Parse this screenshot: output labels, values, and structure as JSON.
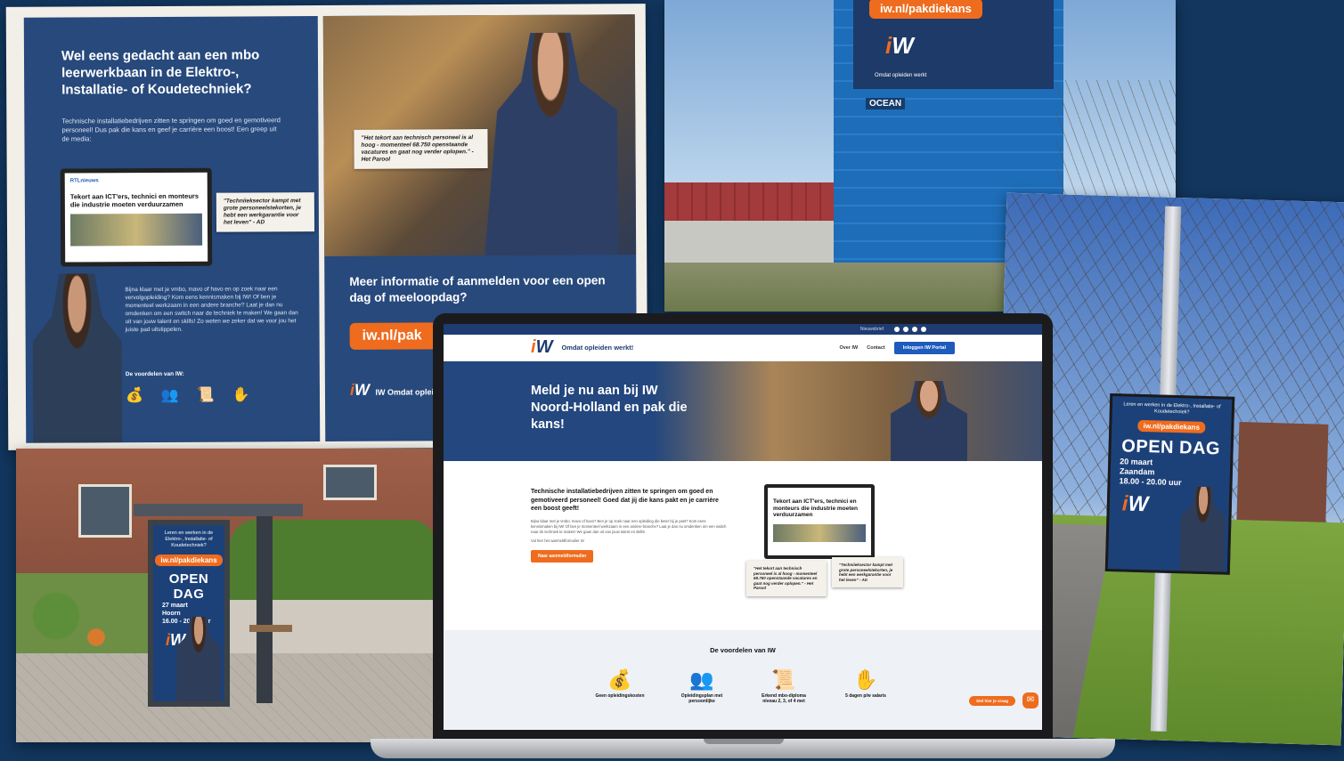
{
  "newspaper": {
    "left_headline": "Wel eens gedacht aan een mbo leerwerkbaan in de Elektro-, Installatie- of Koudetechniek?",
    "left_body": "Technische installatiebedrijven zitten te springen om goed en gemotiveerd personeel! Dus pak die kans en geef je carrière een boost! Een greep uit de media:",
    "article_source": "RTLnieuws",
    "article_title": "Tekort aan ICT'ers, technici en monteurs die industrie moeten verduurzamen",
    "quote_ab": "\"Techniieksector kampt met grote personeelstekorten, je hebt een werkgarantie voor het leven\" - AD",
    "left_body2": "Bijna klaar met je vmbo, mavo of havo en op zoek naar een vervolgopleiding? Kom eens kennismaken bij IW! Of ben je momenteel werkzaam in een andere branche? Laat je dan nu omdenken om een switch naar de techniek te maken! We gaan dan uit van jouw talent en skills! Zo weten we zeker dat we voor jou het juiste pad uitstippelen.",
    "benefits_title": "De voordelen van IW:",
    "quote_parool": "\"Het tekort aan technisch personeel is al hoog - momenteel 68.750 openstaande vacatures en gaat nog verder oplopen.\" - Het Parool",
    "right_cta": "Meer informatie of aanmelden voor een open dag of meeloopdag?",
    "right_url": "iw.nl/pak",
    "brand_line": "IW Omdat opleid"
  },
  "billboard": {
    "url": "iw.nl/pakdiekans",
    "tagline": "Omdat opleiden werkt",
    "tower_label": "OCEAN"
  },
  "roadside_poster": {
    "small": "Leren en werken in de Elektro-, Installatie- of Koudetechniek?",
    "url": "iw.nl/pakdiekans",
    "open_dag": "OPEN DAG",
    "date": "20 maart",
    "place": "Zaandam",
    "time": "18.00 - 20.00 uur"
  },
  "shelter_poster": {
    "small": "Leren en werken in de Elektro-, Installatie- of Koudetechniek?",
    "url": "iw.nl/pakdiekans",
    "open_dag": "OPEN DAG",
    "date": "27 maart",
    "place": "Hoorn",
    "time": "16.00 - 20.00 uur"
  },
  "website": {
    "logo": "IW",
    "slogan": "Omdat opleiden werkt!",
    "menu": [
      "Over IW",
      "Contact"
    ],
    "portal_button": "Inloggen IW Portal",
    "topbar_label": "Nieuwsbrief",
    "hero_title": "Meld je nu aan bij IW Noord-Holland en pak die kans!",
    "intro_title": "Technische installatiebedrijven zitten te springen om goed en gemotiveerd personeel! Goed dat jij die kans pakt en je carrière een boost geeft!",
    "intro_body": "Bijna klaar met je vmbo, mavo of havo? Ben je op zoek naar een opleiding die beter bij je past? Kom eens kennismaken bij IW! Of ben je momenteel werkzaam in een andere branche? Laat je dan nu omdenken om een switch naar de techniek te maken! We gaan dan uit van jouw talent en skills!",
    "intro_link": "Vul hier het aanmeldformulier in!",
    "intro_button": "Naar aanmeldformulier",
    "benefits_title": "De voordelen van IW",
    "benefits": [
      {
        "icon": "money-bag-icon",
        "glyph": "💰",
        "label": "Geen opleidingskosten"
      },
      {
        "icon": "people-icon",
        "glyph": "👥",
        "label": "Opleidingsplan met persoonlijke"
      },
      {
        "icon": "diploma-icon",
        "glyph": "📜",
        "label": "Erkend mbo-diploma niveau 2, 3, of 4 met"
      },
      {
        "icon": "hand-coin-icon",
        "glyph": "✋",
        "label": "5 dagen p/w salaris"
      }
    ],
    "chat_label": "Stel hier je vraag"
  }
}
